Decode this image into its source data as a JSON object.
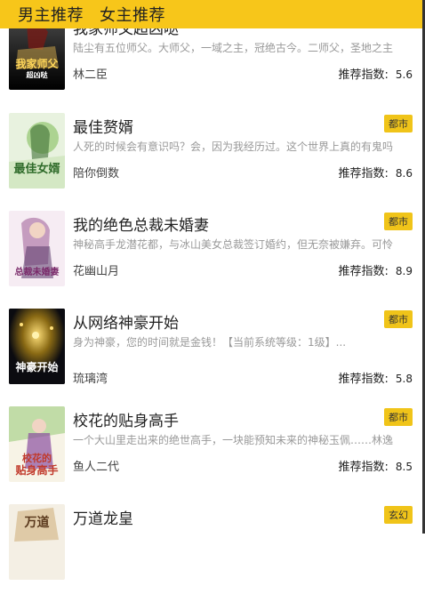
{
  "tabs": [
    {
      "label": "男主推荐"
    },
    {
      "label": "女主推荐"
    }
  ],
  "score_label": "推荐指数:",
  "books": [
    {
      "title": "我家师父超凶哒",
      "badge": "",
      "desc": "陆尘有五位师父。大师父，一域之主，冠绝古今。二师父，圣地之主",
      "author": "林二臣",
      "score": "5.6",
      "cover_text": "我家师父",
      "cover_sub": "超凶哒",
      "cover_colors": [
        "#2a2a2a",
        "#7a1a14",
        "#c8a24a"
      ]
    },
    {
      "title": "最佳赘婿",
      "badge": "都市",
      "desc": "人死的时候会有意识吗？会，因为我经历过。这个世界上真的有鬼吗",
      "author": "陪你倒数",
      "score": "8.6",
      "cover_text": "最佳女婿",
      "cover_sub": "",
      "cover_colors": [
        "#e8f0e0",
        "#6aa84f",
        "#2f6b2a"
      ]
    },
    {
      "title": "我的绝色总裁未婚妻",
      "badge": "都市",
      "desc": "神秘高手龙潜花都，与冰山美女总裁签订婚约，但无奈被嫌弃。可怜",
      "author": "花幽山月",
      "score": "8.9",
      "cover_text": "总裁未婚妻",
      "cover_sub": "",
      "cover_colors": [
        "#f3e6f0",
        "#b07aa8",
        "#5a3a6a"
      ]
    },
    {
      "title": "从网络神豪开始",
      "badge": "都市",
      "desc": "身为神豪，您的时间就是金钱！【当前系统等级：1级】...",
      "author": "琉璃湾",
      "score": "5.8",
      "cover_text": "神豪开始",
      "cover_sub": "",
      "cover_colors": [
        "#0b0b10",
        "#c9a227",
        "#1a1a24"
      ]
    },
    {
      "title": "校花的贴身高手",
      "badge": "都市",
      "desc": "一个大山里走出来的绝世高手，一块能预知未来的神秘玉佩……林逸是",
      "author": "鱼人二代",
      "score": "8.5",
      "cover_text": "校花的",
      "cover_sub": "贴身高手",
      "cover_colors": [
        "#f7f3e6",
        "#a9d28c",
        "#8a4fa0"
      ]
    },
    {
      "title": "万道龙皇",
      "badge": "玄幻",
      "desc": "",
      "author": "",
      "score": "",
      "cover_text": "万道",
      "cover_sub": "",
      "cover_colors": [
        "#f4efe4",
        "#caa56a",
        "#5b3a1e"
      ]
    }
  ]
}
